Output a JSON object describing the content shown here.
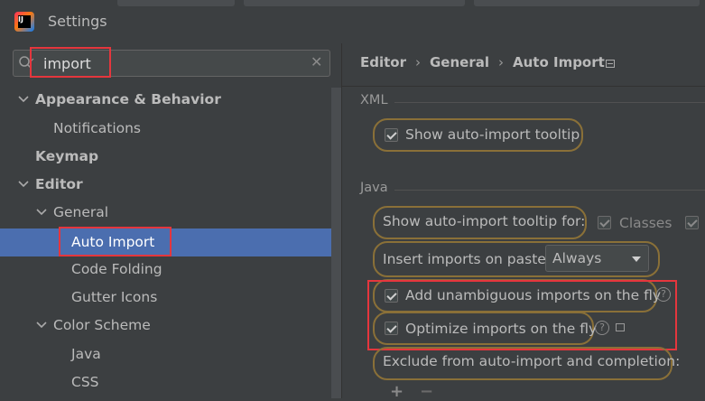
{
  "window": {
    "title": "Settings",
    "logo_text": "IJ"
  },
  "search": {
    "value": "import",
    "placeholder": ""
  },
  "tree": {
    "items": [
      {
        "label": "Appearance & Behavior"
      },
      {
        "label": "Notifications"
      },
      {
        "label": "Keymap"
      },
      {
        "label": "Editor"
      },
      {
        "label": "General"
      },
      {
        "label": "Auto Import"
      },
      {
        "label": "Code Folding"
      },
      {
        "label": "Gutter Icons"
      },
      {
        "label": "Color Scheme"
      },
      {
        "label": "Java"
      },
      {
        "label": "CSS"
      }
    ],
    "selected": "Auto Import"
  },
  "breadcrumb": {
    "items": [
      "Editor",
      "General",
      "Auto Import"
    ],
    "separator": "›"
  },
  "sections": {
    "xml": {
      "label": "XML",
      "show_tooltip": {
        "label": "Show auto-import tooltip",
        "checked": true
      }
    },
    "java": {
      "label": "Java",
      "show_tooltip_for": {
        "label": "Show auto-import tooltip for:",
        "classes_label": "Classes",
        "classes_checked": true
      },
      "insert_on_paste": {
        "label": "Insert imports on paste:",
        "value": "Always"
      },
      "add_unambiguous": {
        "label": "Add unambiguous imports on the fly",
        "checked": true
      },
      "optimize": {
        "label": "Optimize imports on the fly",
        "checked": true
      },
      "exclude": {
        "label": "Exclude from auto-import and completion:"
      },
      "add_label": "+",
      "remove_label": "−"
    }
  },
  "colors": {
    "selection": "#4b6eaf",
    "highlight_box": "#e5363d",
    "search_outline": "#8a7038"
  }
}
